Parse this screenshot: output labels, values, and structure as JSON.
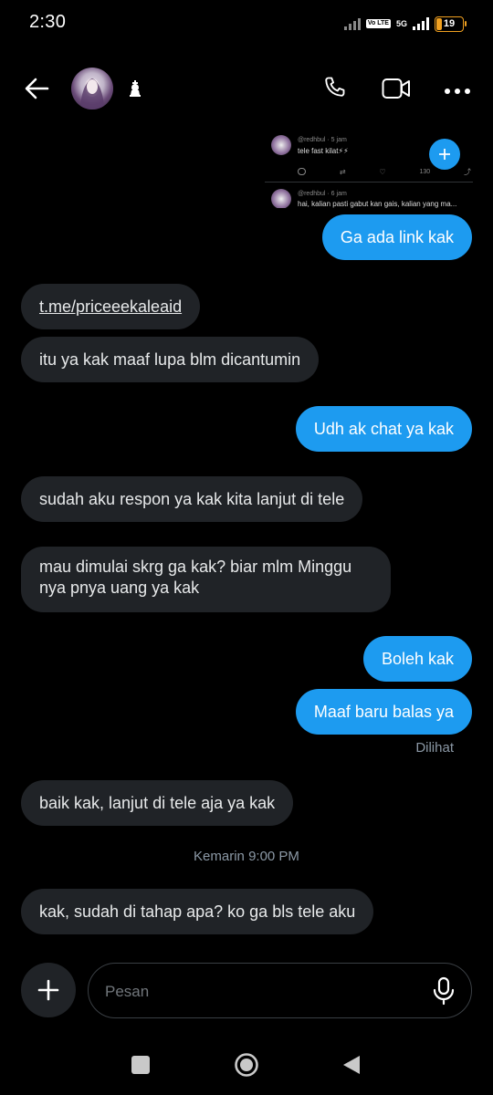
{
  "status": {
    "time": "2:30",
    "battery": "19",
    "network": "5G",
    "volte": "Vo LTE"
  },
  "header": {
    "back_icon": "arrow-left-icon",
    "call_icon": "phone-icon",
    "video_icon": "video-icon",
    "more_icon": "more-horizontal-icon"
  },
  "preview": {
    "post1_user": "@redhbul · 5 jam",
    "post1_text": "tele fast kilat⚡⚡",
    "post1_count": "130",
    "post2_user": "@redhbul · 6 jam",
    "post2_text": "hai, kalian pasti gabut kan gais, kalian yang ma..."
  },
  "messages": [
    {
      "side": "out",
      "text": "Ga ada link kak"
    },
    {
      "side": "in",
      "text": "t.me/priceeekaleaid"
    },
    {
      "side": "in",
      "text": "itu ya kak maaf lupa blm dicantumin"
    },
    {
      "side": "out",
      "text": "Udh ak chat ya kak"
    },
    {
      "side": "in",
      "text": "sudah aku respon ya kak kita lanjut di tele"
    },
    {
      "side": "in",
      "text": "mau dimulai skrg ga kak? biar mlm Minggu nya pnya uang ya kak"
    },
    {
      "side": "out",
      "text": "Boleh kak"
    },
    {
      "side": "out",
      "text": "Maaf baru balas ya"
    },
    {
      "side": "in",
      "text": "baik kak, lanjut di tele aja ya kak"
    },
    {
      "side": "in",
      "text": "kak, sudah di tahap apa? ko ga bls tele aku"
    }
  ],
  "seen_label": "Dilihat",
  "date_divider": "Kemarin 9:00 PM",
  "composer": {
    "placeholder": "Pesan"
  },
  "colors": {
    "bg": "#000000",
    "incoming": "#202327",
    "outgoing": "#1d9bf0",
    "muted": "#8b98a5"
  }
}
